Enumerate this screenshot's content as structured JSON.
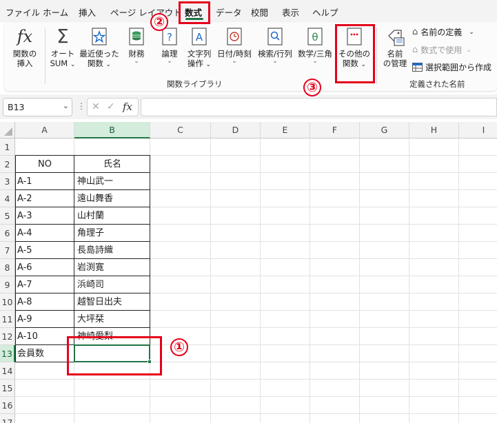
{
  "menu": {
    "tabs": [
      "ファイル",
      "ホーム",
      "挿入",
      "ページ レイアウト",
      "数式",
      "データ",
      "校閲",
      "表示",
      "ヘルプ"
    ],
    "active": "数式"
  },
  "ribbon": {
    "insert_function": [
      "関数の",
      "挿入"
    ],
    "autosum": [
      "オート",
      "SUM"
    ],
    "recent": [
      "最近使った",
      "関数"
    ],
    "financial": "財務",
    "logical": "論理",
    "text": [
      "文字列",
      "操作"
    ],
    "datetime": "日付/時刻",
    "lookup": "検索/行列",
    "math": "数学/三角",
    "more": [
      "その他の",
      "関数"
    ],
    "name_manager": [
      "名前",
      "の管理"
    ],
    "define_name": "名前の定義",
    "use_in_formula": "数式で使用",
    "create_from_selection": "選択範囲から作成",
    "group_library": "関数ライブラリ",
    "group_names": "定義された名前",
    "chevron": "⌄"
  },
  "formula_bar": {
    "name_box": "B13",
    "fx": "fx",
    "cancel": "✕",
    "enter": "✓",
    "formula": ""
  },
  "sheet": {
    "columns": [
      "A",
      "B",
      "C",
      "D",
      "E",
      "F",
      "G",
      "H",
      "I"
    ],
    "rows": [
      "1",
      "2",
      "3",
      "4",
      "5",
      "6",
      "7",
      "8",
      "9",
      "10",
      "11",
      "12",
      "13",
      "14",
      "15",
      "16",
      "17"
    ],
    "header": {
      "no": "NO",
      "name": "氏名"
    },
    "records": [
      {
        "no": "A-1",
        "name": "神山武一"
      },
      {
        "no": "A-2",
        "name": "遠山舞香"
      },
      {
        "no": "A-3",
        "name": "山村蘭"
      },
      {
        "no": "A-4",
        "name": "角理子"
      },
      {
        "no": "A-5",
        "name": "長島詩織"
      },
      {
        "no": "A-6",
        "name": "岩渕寛"
      },
      {
        "no": "A-7",
        "name": "浜崎司"
      },
      {
        "no": "A-8",
        "name": "越智日出夫"
      },
      {
        "no": "A-9",
        "name": "大坪栞"
      },
      {
        "no": "A-10",
        "name": "神崎愛梨"
      }
    ],
    "total_label": "会員数",
    "total_value": ""
  },
  "annotations": {
    "step1": "①",
    "step2": "②",
    "step3": "③"
  },
  "colors": {
    "accent": "#217346",
    "annotation": "#e4001a"
  }
}
